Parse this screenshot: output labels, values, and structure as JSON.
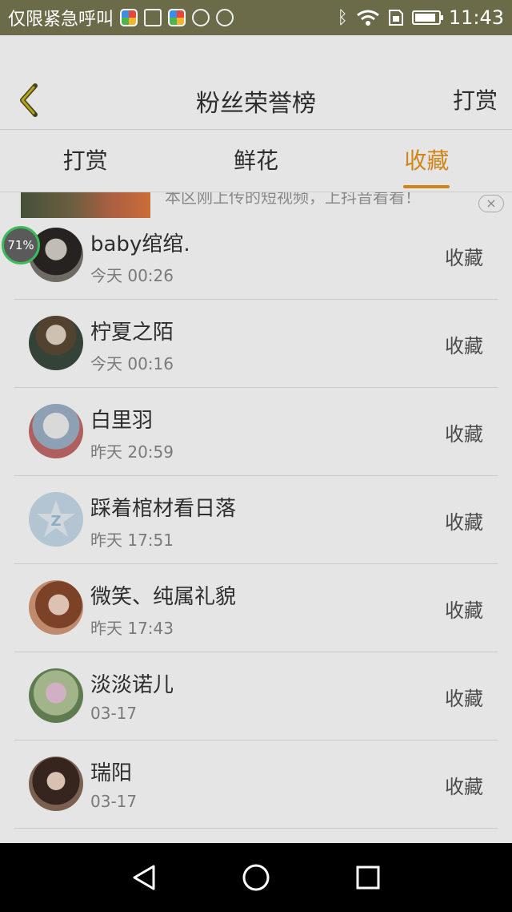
{
  "status_bar": {
    "carrier": "仅限紧急呼叫",
    "time": "11:43",
    "icons": [
      "app-color-icon",
      "image-icon",
      "app-color-icon",
      "face-icon",
      "music-icon",
      "bluetooth-icon",
      "wifi-icon",
      "sim-icon",
      "battery-icon"
    ]
  },
  "header": {
    "back_icon": "chevron-left-icon",
    "title": "粉丝荣誉榜",
    "action": "打赏"
  },
  "tabs": [
    {
      "label": "打赏",
      "active": false
    },
    {
      "label": "鲜花",
      "active": false
    },
    {
      "label": "收藏",
      "active": true
    }
  ],
  "ad": {
    "text": "本区刚上传的短视频，上抖音看看！",
    "close": "×"
  },
  "badge": {
    "percent": "71%"
  },
  "list": [
    {
      "name": "baby绾绾.",
      "time": "今天 00:26",
      "action": "收藏"
    },
    {
      "name": "柠夏之陌",
      "time": "今天 00:16",
      "action": "收藏"
    },
    {
      "name": "白里羽",
      "time": "昨天 20:59",
      "action": "收藏"
    },
    {
      "name": "踩着棺材看日落",
      "time": "昨天 17:51",
      "action": "收藏"
    },
    {
      "name": "微笑、纯属礼貌",
      "time": "昨天 17:43",
      "action": "收藏"
    },
    {
      "name": "淡淡诺儿",
      "time": "03-17",
      "action": "收藏"
    },
    {
      "name": "瑞阳",
      "time": "03-17",
      "action": "收藏"
    }
  ],
  "colors": {
    "accent": "#e8951c",
    "status_bar": "#6b6b4a",
    "nav_bar": "#000000"
  },
  "battery_level": 0.9
}
